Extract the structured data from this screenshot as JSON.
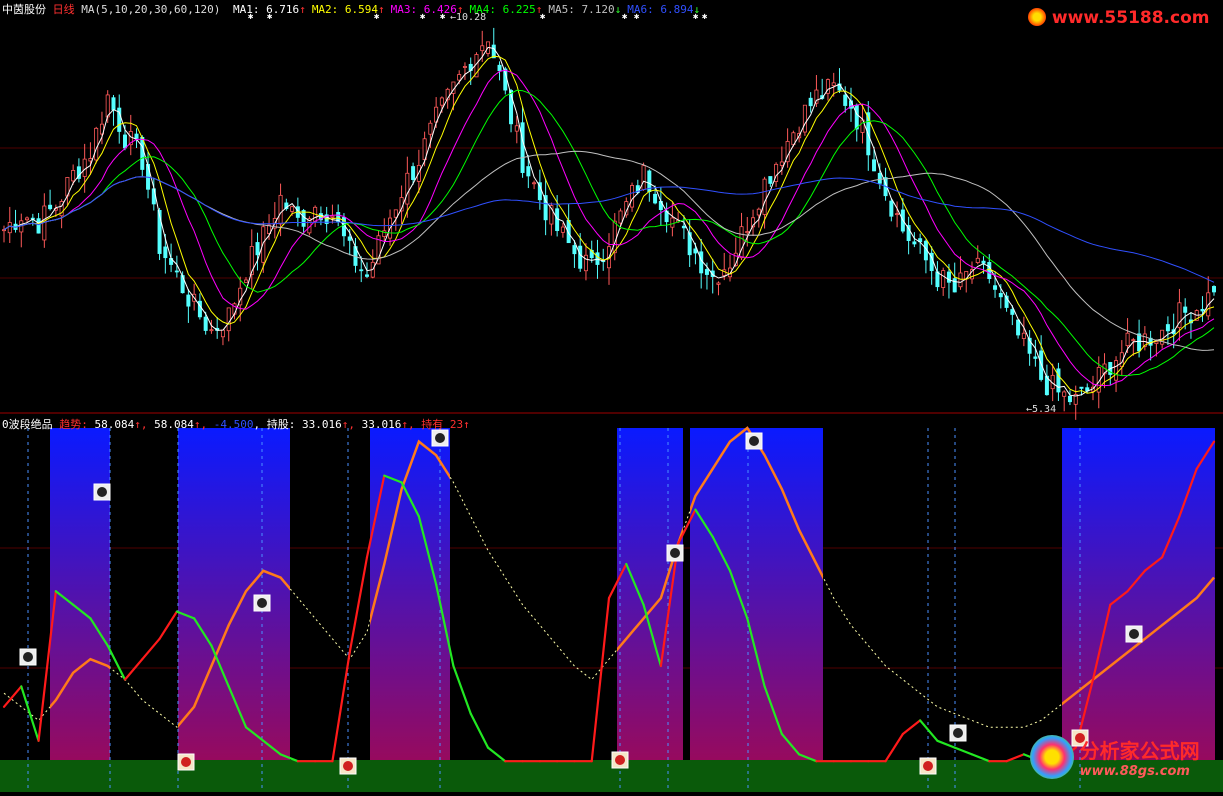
{
  "stock": {
    "name": "中茵股份",
    "period": "日线"
  },
  "ma_header": {
    "label": "MA(5,10,20,30,60,120)",
    "items": [
      {
        "name": "MA1:",
        "value": "6.716",
        "arrow": "↑",
        "color": "#ffffff"
      },
      {
        "name": "MA2:",
        "value": "6.594",
        "arrow": "↑",
        "color": "#ffff00"
      },
      {
        "name": "MA3:",
        "value": "6.426",
        "arrow": "↑",
        "color": "#ff00ff"
      },
      {
        "name": "MA4:",
        "value": "6.225",
        "arrow": "↑",
        "color": "#00ff00"
      },
      {
        "name": "MA5:",
        "value": "7.120",
        "arrow": "↓",
        "color": "#c0c0c0"
      },
      {
        "name": "MA6:",
        "value": "6.894",
        "arrow": "↓",
        "color": "#3050ff"
      }
    ]
  },
  "price_annotations": {
    "high": "10.28",
    "low": "5.34"
  },
  "indicator_header": {
    "name": "0波段绝品",
    "trend_label": "趋势:",
    "trend_value1": "58.084",
    "trend_value2": "58.084",
    "trend_value3": "-4.500",
    "hold_label": "持股:",
    "hold_value1": "33.016",
    "hold_value2": "33.016",
    "status_label": "持有",
    "status_value": "23"
  },
  "watermarks": {
    "top": "www.55188.com",
    "bottom_cn": "分析家公式网",
    "bottom_url": "www.88gs.com"
  },
  "colors": {
    "up": "#ff5a5a",
    "down": "#54ffff",
    "trend_up": "#ff1a1a",
    "trend_down": "#22e822",
    "hold_line": "#ff7a1a",
    "band_top": "#0a1aff",
    "band_bottom": "#9a0a5a",
    "base": "#0a5a0a"
  },
  "chart_data": {
    "type": "line",
    "price_ylim": [
      5.34,
      10.28
    ],
    "candles_close_profile": [
      7.6,
      7.8,
      7.7,
      7.9,
      8.3,
      8.6,
      9.3,
      8.8,
      8.5,
      7.4,
      7.0,
      6.6,
      6.3,
      6.5,
      7.1,
      7.5,
      8.0,
      7.7,
      7.9,
      7.8,
      7.3,
      7.0,
      7.6,
      8.1,
      8.5,
      9.0,
      9.4,
      9.8,
      10.1,
      9.3,
      8.5,
      8.0,
      7.6,
      7.3,
      7.1,
      7.5,
      7.9,
      8.3,
      8.0,
      7.6,
      7.3,
      7.0,
      7.2,
      7.7,
      8.2,
      8.6,
      9.0,
      9.3,
      9.4,
      9.2,
      8.7,
      8.1,
      7.6,
      7.3,
      7.0,
      6.8,
      7.1,
      7.0,
      6.5,
      6.1,
      5.7,
      5.5,
      5.4,
      5.6,
      5.9,
      6.1,
      6.2,
      6.3,
      6.5,
      6.6,
      6.8
    ],
    "trend_profile": [
      18,
      24,
      8,
      52,
      48,
      44,
      36,
      26,
      32,
      38,
      46,
      44,
      36,
      24,
      12,
      8,
      4,
      2,
      2,
      2,
      34,
      62,
      86,
      84,
      74,
      54,
      30,
      16,
      6,
      2,
      2,
      2,
      2,
      2,
      2,
      50,
      60,
      48,
      30,
      66,
      76,
      68,
      58,
      44,
      24,
      10,
      4,
      2,
      2,
      2,
      2,
      2,
      10,
      14,
      8,
      6,
      4,
      2,
      2,
      4,
      2,
      2,
      6,
      26,
      48,
      52,
      58,
      62,
      74,
      88,
      96
    ],
    "hold_profile": [
      22,
      18,
      14,
      20,
      28,
      32,
      30,
      26,
      20,
      16,
      12,
      18,
      30,
      42,
      52,
      58,
      56,
      50,
      44,
      38,
      32,
      40,
      60,
      82,
      96,
      92,
      84,
      74,
      64,
      56,
      48,
      42,
      36,
      30,
      26,
      32,
      38,
      44,
      50,
      66,
      80,
      88,
      96,
      100,
      92,
      82,
      70,
      60,
      50,
      42,
      36,
      30,
      26,
      22,
      18,
      16,
      14,
      12,
      12,
      12,
      14,
      18,
      22,
      26,
      30,
      34,
      38,
      42,
      46,
      50,
      56
    ]
  }
}
